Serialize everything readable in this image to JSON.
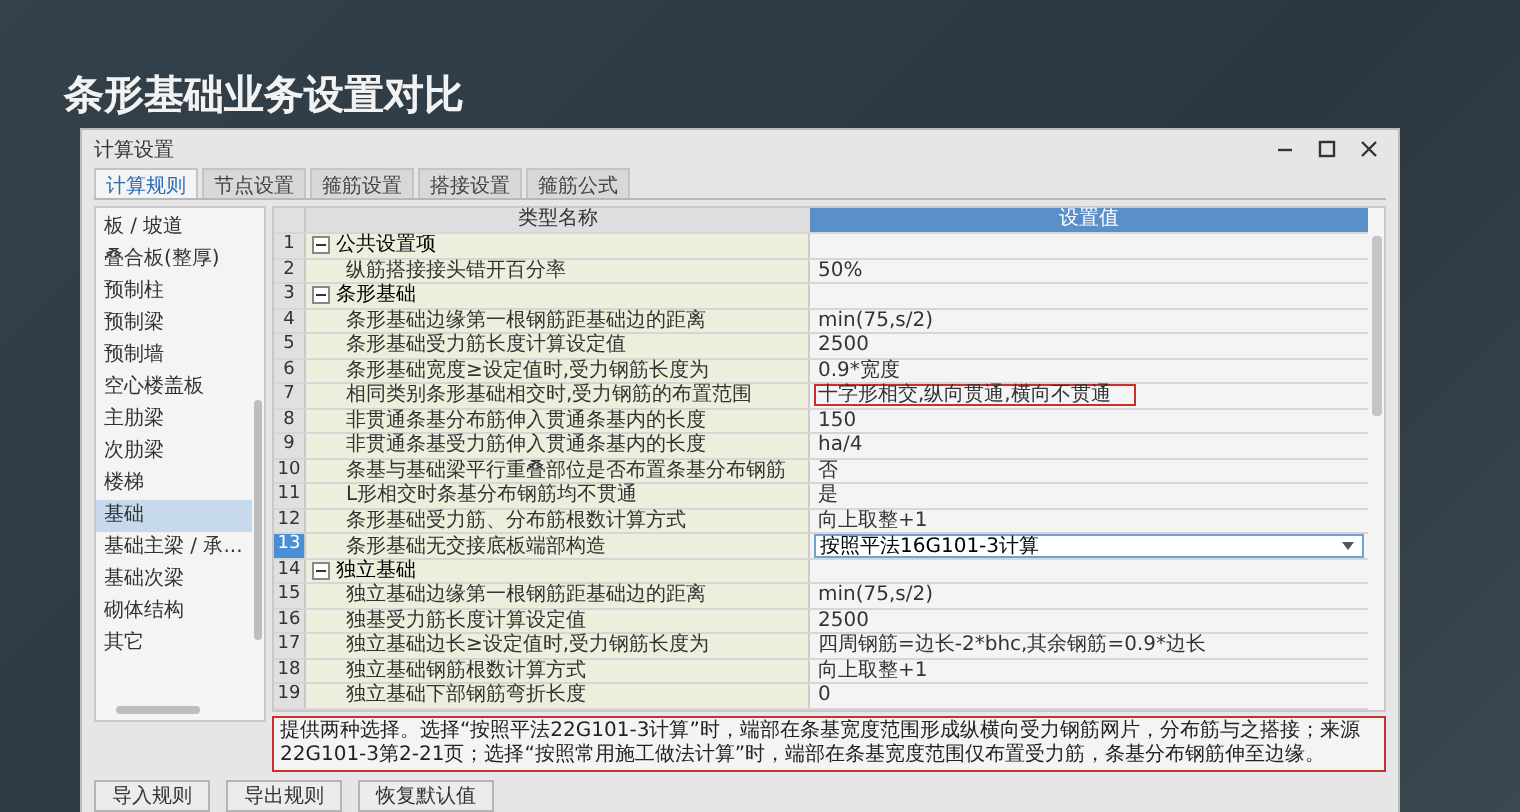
{
  "slide_title": "条形基础业务设置对比",
  "window": {
    "title": "计算设置"
  },
  "tabs": [
    {
      "label": "计算规则",
      "selected": true
    },
    {
      "label": "节点设置",
      "selected": false
    },
    {
      "label": "箍筋设置",
      "selected": false
    },
    {
      "label": "搭接设置",
      "selected": false
    },
    {
      "label": "箍筋公式",
      "selected": false
    }
  ],
  "sidebar": {
    "items": [
      {
        "label": "板 / 坡道",
        "selected": false
      },
      {
        "label": "叠合板(整厚)",
        "selected": false
      },
      {
        "label": "预制柱",
        "selected": false
      },
      {
        "label": "预制梁",
        "selected": false
      },
      {
        "label": "预制墙",
        "selected": false
      },
      {
        "label": "空心楼盖板",
        "selected": false
      },
      {
        "label": "主肋梁",
        "selected": false
      },
      {
        "label": "次肋梁",
        "selected": false
      },
      {
        "label": "楼梯",
        "selected": false
      },
      {
        "label": "基础",
        "selected": true
      },
      {
        "label": "基础主梁 / 承...",
        "selected": false
      },
      {
        "label": "基础次梁",
        "selected": false
      },
      {
        "label": "砌体结构",
        "selected": false
      },
      {
        "label": "其它",
        "selected": false
      }
    ]
  },
  "table": {
    "columns": [
      "类型名称",
      "设置值"
    ],
    "rows": [
      {
        "number": "1",
        "label": "公共设置项",
        "expanded": true,
        "children": [
          {
            "number": "2",
            "label": "纵筋搭接接头错开百分率",
            "value": "50%",
            "kind": "text",
            "selected": false,
            "outlined": false
          }
        ]
      },
      {
        "number": "3",
        "label": "条形基础",
        "expanded": true,
        "children": [
          {
            "number": "4",
            "label": "条形基础边缘第一根钢筋距基础边的距离",
            "value": "min(75,s/2)",
            "kind": "text",
            "selected": false,
            "outlined": false
          },
          {
            "number": "5",
            "label": "条形基础受力筋长度计算设定值",
            "value": "2500",
            "kind": "text",
            "selected": false,
            "outlined": false
          },
          {
            "number": "6",
            "label": "条形基础宽度≥设定值时,受力钢筋长度为",
            "value": "0.9*宽度",
            "kind": "text",
            "selected": false,
            "outlined": false
          },
          {
            "number": "7",
            "label": "相同类别条形基础相交时,受力钢筋的布置范围",
            "value": "十字形相交,纵向贯通,横向不贯通",
            "kind": "text",
            "selected": false,
            "outlined": true
          },
          {
            "number": "8",
            "label": "非贯通条基分布筋伸入贯通条基内的长度",
            "value": "150",
            "kind": "text",
            "selected": false,
            "outlined": false
          },
          {
            "number": "9",
            "label": "非贯通条基受力筋伸入贯通条基内的长度",
            "value": "ha/4",
            "kind": "text",
            "selected": false,
            "outlined": false
          },
          {
            "number": "10",
            "label": "条基与基础梁平行重叠部位是否布置条基分布钢筋",
            "value": "否",
            "kind": "text",
            "selected": false,
            "outlined": false
          },
          {
            "number": "11",
            "label": "L形相交时条基分布钢筋均不贯通",
            "value": "是",
            "kind": "text",
            "selected": false,
            "outlined": false
          },
          {
            "number": "12",
            "label": "条形基础受力筋、分布筋根数计算方式",
            "value": "向上取整+1",
            "kind": "text",
            "selected": false,
            "outlined": false
          },
          {
            "number": "13",
            "label": "条形基础无交接底板端部构造",
            "value": "按照平法16G101-3计算",
            "kind": "dropdown",
            "selected": true,
            "outlined": false
          }
        ]
      },
      {
        "number": "14",
        "label": "独立基础",
        "expanded": true,
        "children": [
          {
            "number": "15",
            "label": "独立基础边缘第一根钢筋距基础边的距离",
            "value": "min(75,s/2)",
            "kind": "text",
            "selected": false,
            "outlined": false
          },
          {
            "number": "16",
            "label": "独基受力筋长度计算设定值",
            "value": "2500",
            "kind": "text",
            "selected": false,
            "outlined": false
          },
          {
            "number": "17",
            "label": "独立基础边长≥设定值时,受力钢筋长度为",
            "value": "四周钢筋=边长-2*bhc,其余钢筋=0.9*边长",
            "kind": "text",
            "selected": false,
            "outlined": false
          },
          {
            "number": "18",
            "label": "独立基础钢筋根数计算方式",
            "value": "向上取整+1",
            "kind": "text",
            "selected": false,
            "outlined": false
          },
          {
            "number": "19",
            "label": "独立基础下部钢筋弯折长度",
            "value": "0",
            "kind": "text",
            "selected": false,
            "outlined": false
          }
        ]
      }
    ]
  },
  "description": {
    "text": "提供两种选择。选择“按照平法22G101-3计算”时，端部在条基宽度范围形成纵横向受力钢筋网片，分布筋与之搭接；来源22G101-3第2-21页；选择“按照常用施工做法计算”时，端部在条基宽度范围仅布置受力筋，条基分布钢筋伸至边缘。",
    "outlined": true
  },
  "buttons": [
    "导入规则",
    "导出规则",
    "恢复默认值"
  ]
}
